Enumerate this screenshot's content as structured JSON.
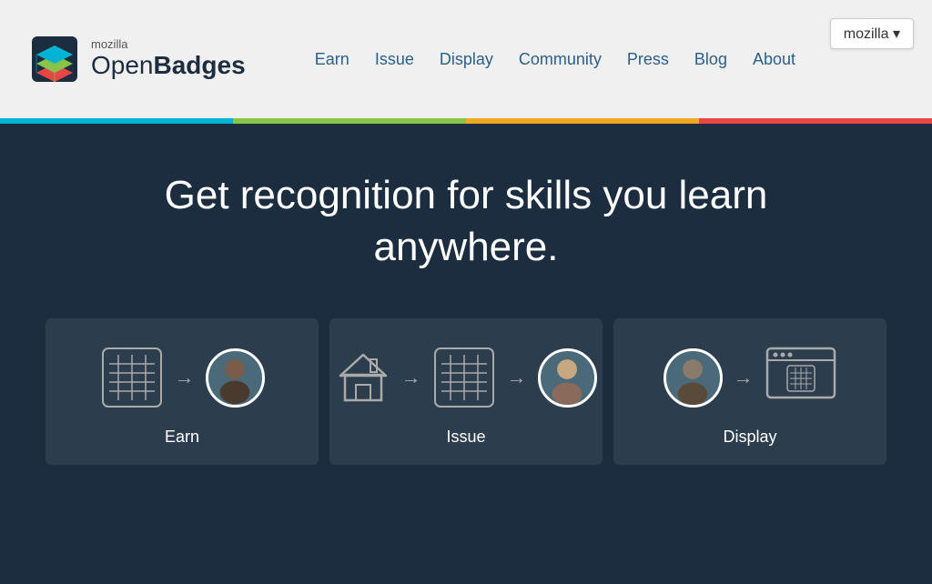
{
  "header": {
    "logo_mozilla": "mozilla",
    "logo_name": "OpenBadges",
    "mozilla_btn": "mozilla ▾"
  },
  "nav": {
    "items": [
      {
        "label": "Earn",
        "id": "earn"
      },
      {
        "label": "Issue",
        "id": "issue"
      },
      {
        "label": "Display",
        "id": "display"
      },
      {
        "label": "Community",
        "id": "community"
      },
      {
        "label": "Press",
        "id": "press"
      },
      {
        "label": "Blog",
        "id": "blog"
      },
      {
        "label": "About",
        "id": "about"
      }
    ]
  },
  "color_bar": {
    "colors": [
      "#00b3d4",
      "#87c44a",
      "#f5a623",
      "#e84545"
    ]
  },
  "hero": {
    "title": "Get recognition for skills you learn anywhere."
  },
  "cards": [
    {
      "label": "Earn",
      "id": "earn-card"
    },
    {
      "label": "Issue",
      "id": "issue-card"
    },
    {
      "label": "Display",
      "id": "display-card"
    }
  ]
}
